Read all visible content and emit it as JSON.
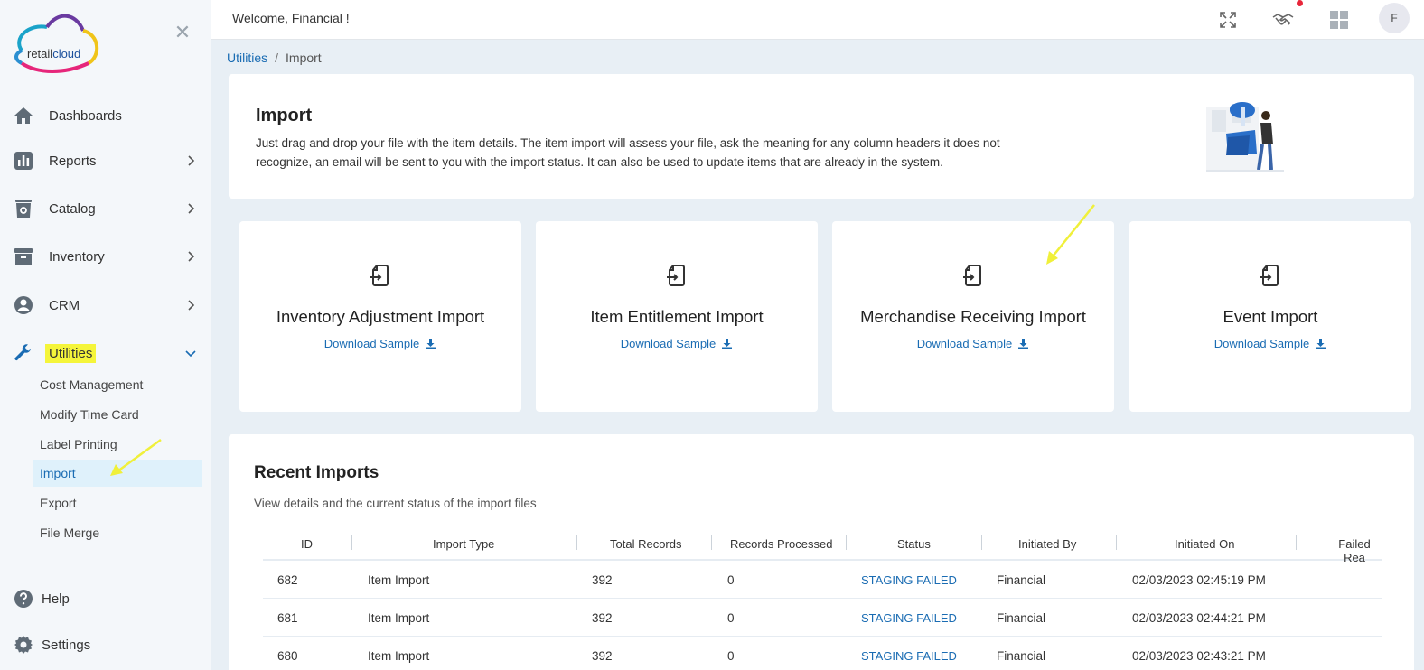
{
  "app": {
    "logo_text_a": "retail",
    "logo_text_b": "cloud",
    "accent": "#1a6cb3"
  },
  "sidebar": {
    "items": [
      {
        "label": "Dashboards",
        "icon": "home-icon"
      },
      {
        "label": "Reports",
        "icon": "bar-chart-icon"
      },
      {
        "label": "Catalog",
        "icon": "catalog-icon"
      },
      {
        "label": "Inventory",
        "icon": "archive-icon"
      },
      {
        "label": "CRM",
        "icon": "user-circle-icon"
      },
      {
        "label": "Utilities",
        "icon": "wrench-icon"
      }
    ],
    "sub_items": [
      "Cost Management",
      "Modify Time Card",
      "Label Printing",
      "Import",
      "Export",
      "File Merge"
    ],
    "help": "Help",
    "settings": "Settings"
  },
  "topbar": {
    "welcome": "Welcome, Financial !",
    "avatar": "F"
  },
  "breadcrumb": {
    "root": "Utilities",
    "sep": "/",
    "current": "Import"
  },
  "header": {
    "title": "Import",
    "description": "Just drag and drop your file with the item details. The item import will assess your file, ask the meaning for any column headers it does not recognize, an email will be sent to you with the import status. It can also be used to update items that are already in the system."
  },
  "import_cards": [
    {
      "title": "Inventory Adjustment Import",
      "link": "Download Sample"
    },
    {
      "title": "Item Entitlement Import",
      "link": "Download Sample"
    },
    {
      "title": "Merchandise Receiving Import",
      "link": "Download Sample"
    },
    {
      "title": "Event Import",
      "link": "Download Sample"
    }
  ],
  "recent": {
    "title": "Recent Imports",
    "subtitle": "View details and the current status of the import files",
    "columns": [
      "ID",
      "Import Type",
      "Total Records",
      "Records Processed",
      "Status",
      "Initiated By",
      "Initiated On",
      "Failed Rea"
    ],
    "rows": [
      [
        "682",
        "Item Import",
        "392",
        "0",
        "STAGING FAILED",
        "Financial",
        "02/03/2023 02:45:19 PM"
      ],
      [
        "681",
        "Item Import",
        "392",
        "0",
        "STAGING FAILED",
        "Financial",
        "02/03/2023 02:44:21 PM"
      ],
      [
        "680",
        "Item Import",
        "392",
        "0",
        "STAGING FAILED",
        "Financial",
        "02/03/2023 02:43:21 PM"
      ]
    ]
  }
}
